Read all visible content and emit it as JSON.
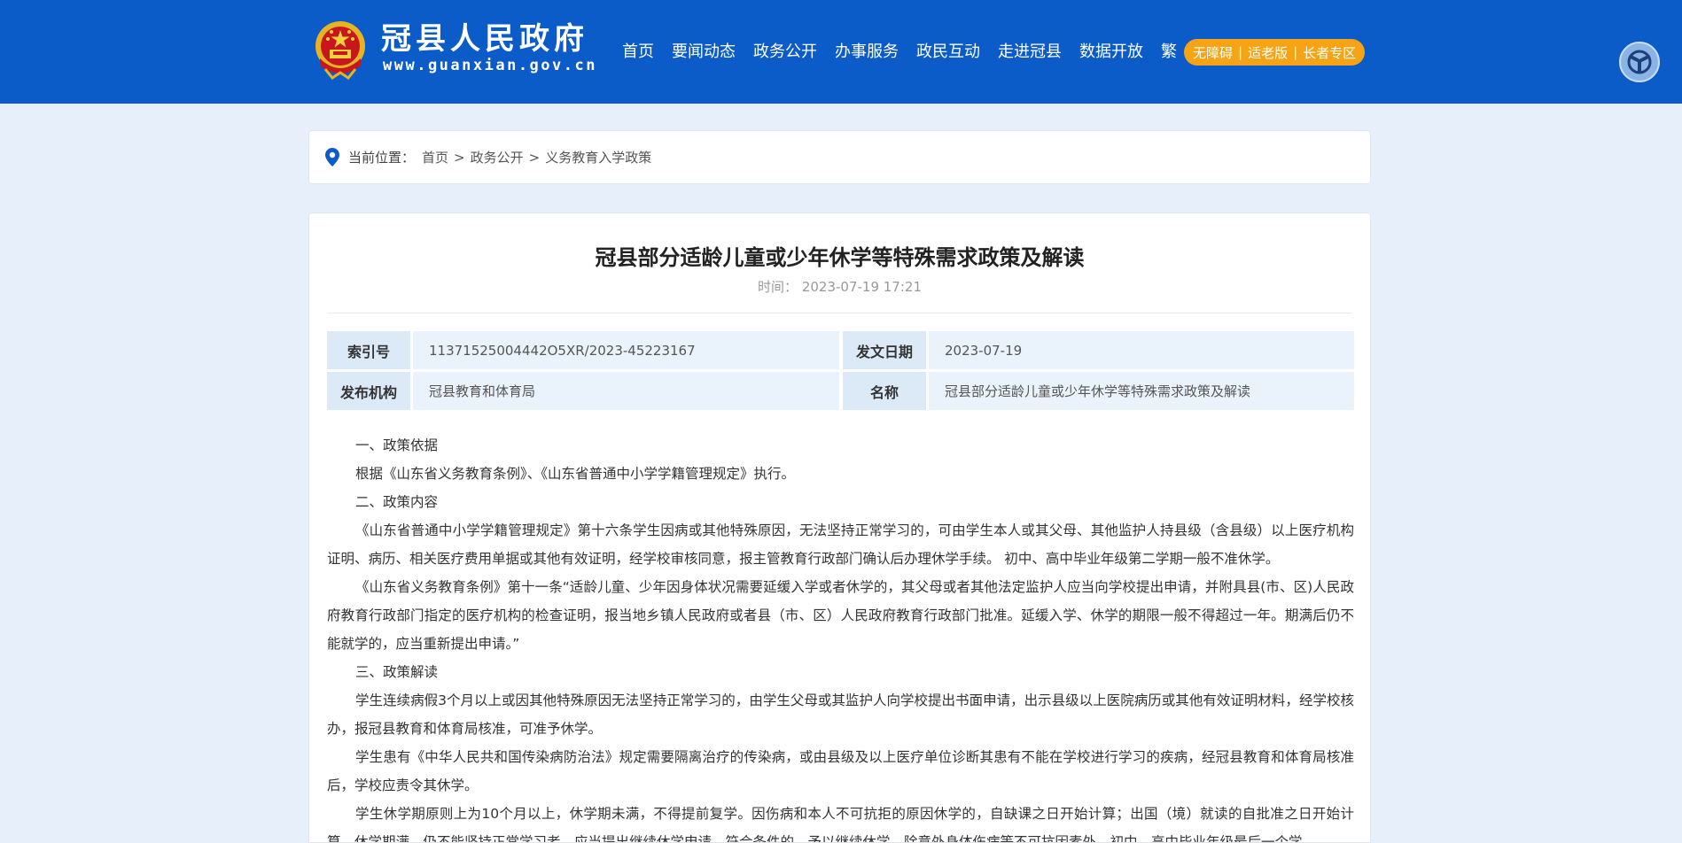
{
  "header": {
    "site_name": "冠县人民政府",
    "site_url": "www.guanxian.gov.cn",
    "nav": [
      "首页",
      "要闻动态",
      "政务公开",
      "办事服务",
      "政民互动",
      "走进冠县",
      "数据开放"
    ],
    "fan_label": "繁",
    "pill": [
      "无障碍",
      "适老版",
      "长者专区"
    ],
    "pill_sep": "|",
    "brand_color": "#0b5cc8",
    "pill_color": "#f6a416"
  },
  "breadcrumb": {
    "prefix": "当前位置：",
    "items": [
      "首页",
      "政务公开",
      "义务教育入学政策"
    ],
    "sep": ">"
  },
  "article": {
    "title": "冠县部分适龄儿童或少年休学等特殊需求政策及解读",
    "time_label": "时间：",
    "time_value": "2023-07-19 17:21",
    "meta": {
      "index_key": "索引号",
      "index_val": "11371525004442O5XR/2023-45223167",
      "date_key": "发文日期",
      "date_val": "2023-07-19",
      "org_key": "发布机构",
      "org_val": "冠县教育和体育局",
      "name_key": "名称",
      "name_val": "冠县部分适龄儿童或少年休学等特殊需求政策及解读"
    },
    "paragraphs": [
      "一、政策依据",
      "根据《山东省义务教育条例》、《山东省普通中小学学籍管理规定》执行。",
      "二、政策内容",
      "《山东省普通中小学学籍管理规定》第十六条学生因病或其他特殊原因，无法坚持正常学习的，可由学生本人或其父母、其他监护人持县级（含县级）以上医疗机构证明、病历、相关医疗费用单据或其他有效证明，经学校审核同意，报主管教育行政部门确认后办理休学手续。 初中、高中毕业年级第二学期一般不准休学。",
      "《山东省义务教育条例》第十一条“适龄儿童、少年因身体状况需要延缓入学或者休学的，其父母或者其他法定监护人应当向学校提出申请，并附具县(市、区)人民政府教育行政部门指定的医疗机构的检查证明，报当地乡镇人民政府或者县（市、区）人民政府教育行政部门批准。延缓入学、休学的期限一般不得超过一年。期满后仍不能就学的，应当重新提出申请。”",
      "三、政策解读",
      "学生连续病假3个月以上或因其他特殊原因无法坚持正常学习的，由学生父母或其监护人向学校提出书面申请，出示县级以上医院病历或其他有效证明材料，经学校核办，报冠县教育和体育局核准，可准予休学。",
      "学生患有《中华人民共和国传染病防治法》规定需要隔离治疗的传染病，或由县级及以上医疗单位诊断其患有不能在学校进行学习的疾病，经冠县教育和体育局核准后，学校应责令其休学。",
      "学生休学期原则上为10个月以上，休学期未满，不得提前复学。因伤病和本人不可抗拒的原因休学的，自缺课之日开始计算；出国（境）就读的自批准之日开始计算。休学期满，仍不能坚持正常学习者，应当提出继续休学申请，符合条件的，予以继续休学。除意外身体伤病等不可抗因素外，初中、高中毕业年级最后一个学"
    ]
  }
}
